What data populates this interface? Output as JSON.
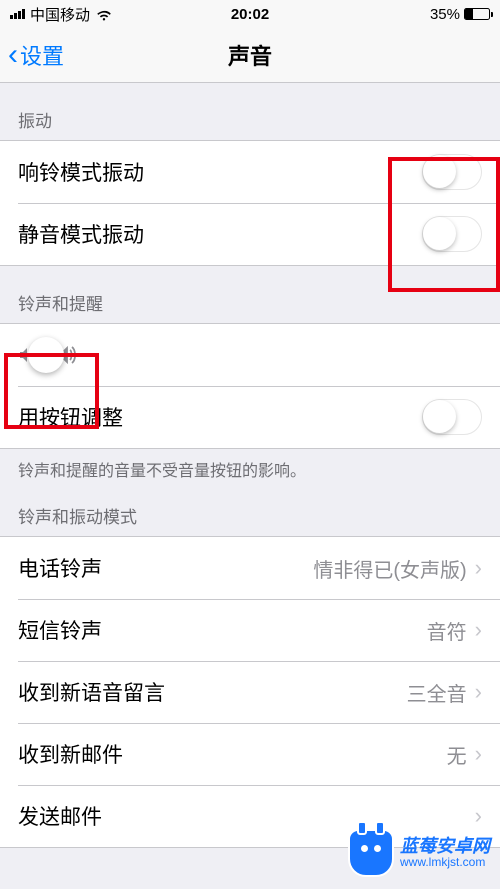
{
  "status": {
    "carrier": "中国移动",
    "time": "20:02",
    "battery_pct": "35%"
  },
  "nav": {
    "back_label": "设置",
    "title": "声音"
  },
  "sections": {
    "vibration": {
      "header": "振动",
      "ring_vibrate": "响铃模式振动",
      "silent_vibrate": "静音模式振动"
    },
    "ringer": {
      "header": "铃声和提醒",
      "button_adjust": "用按钮调整",
      "footer": "铃声和提醒的音量不受音量按钮的影响。"
    },
    "sounds": {
      "header": "铃声和振动模式",
      "ringtone_label": "电话铃声",
      "ringtone_value": "情非得已(女声版)",
      "text_label": "短信铃声",
      "text_value": "音符",
      "voicemail_label": "收到新语音留言",
      "voicemail_value": "三全音",
      "mail_label": "收到新邮件",
      "mail_value": "无",
      "sent_mail_label": "发送邮件"
    }
  },
  "watermark": {
    "line1": "蓝莓安卓网",
    "line2": "www.lmkjst.com"
  }
}
